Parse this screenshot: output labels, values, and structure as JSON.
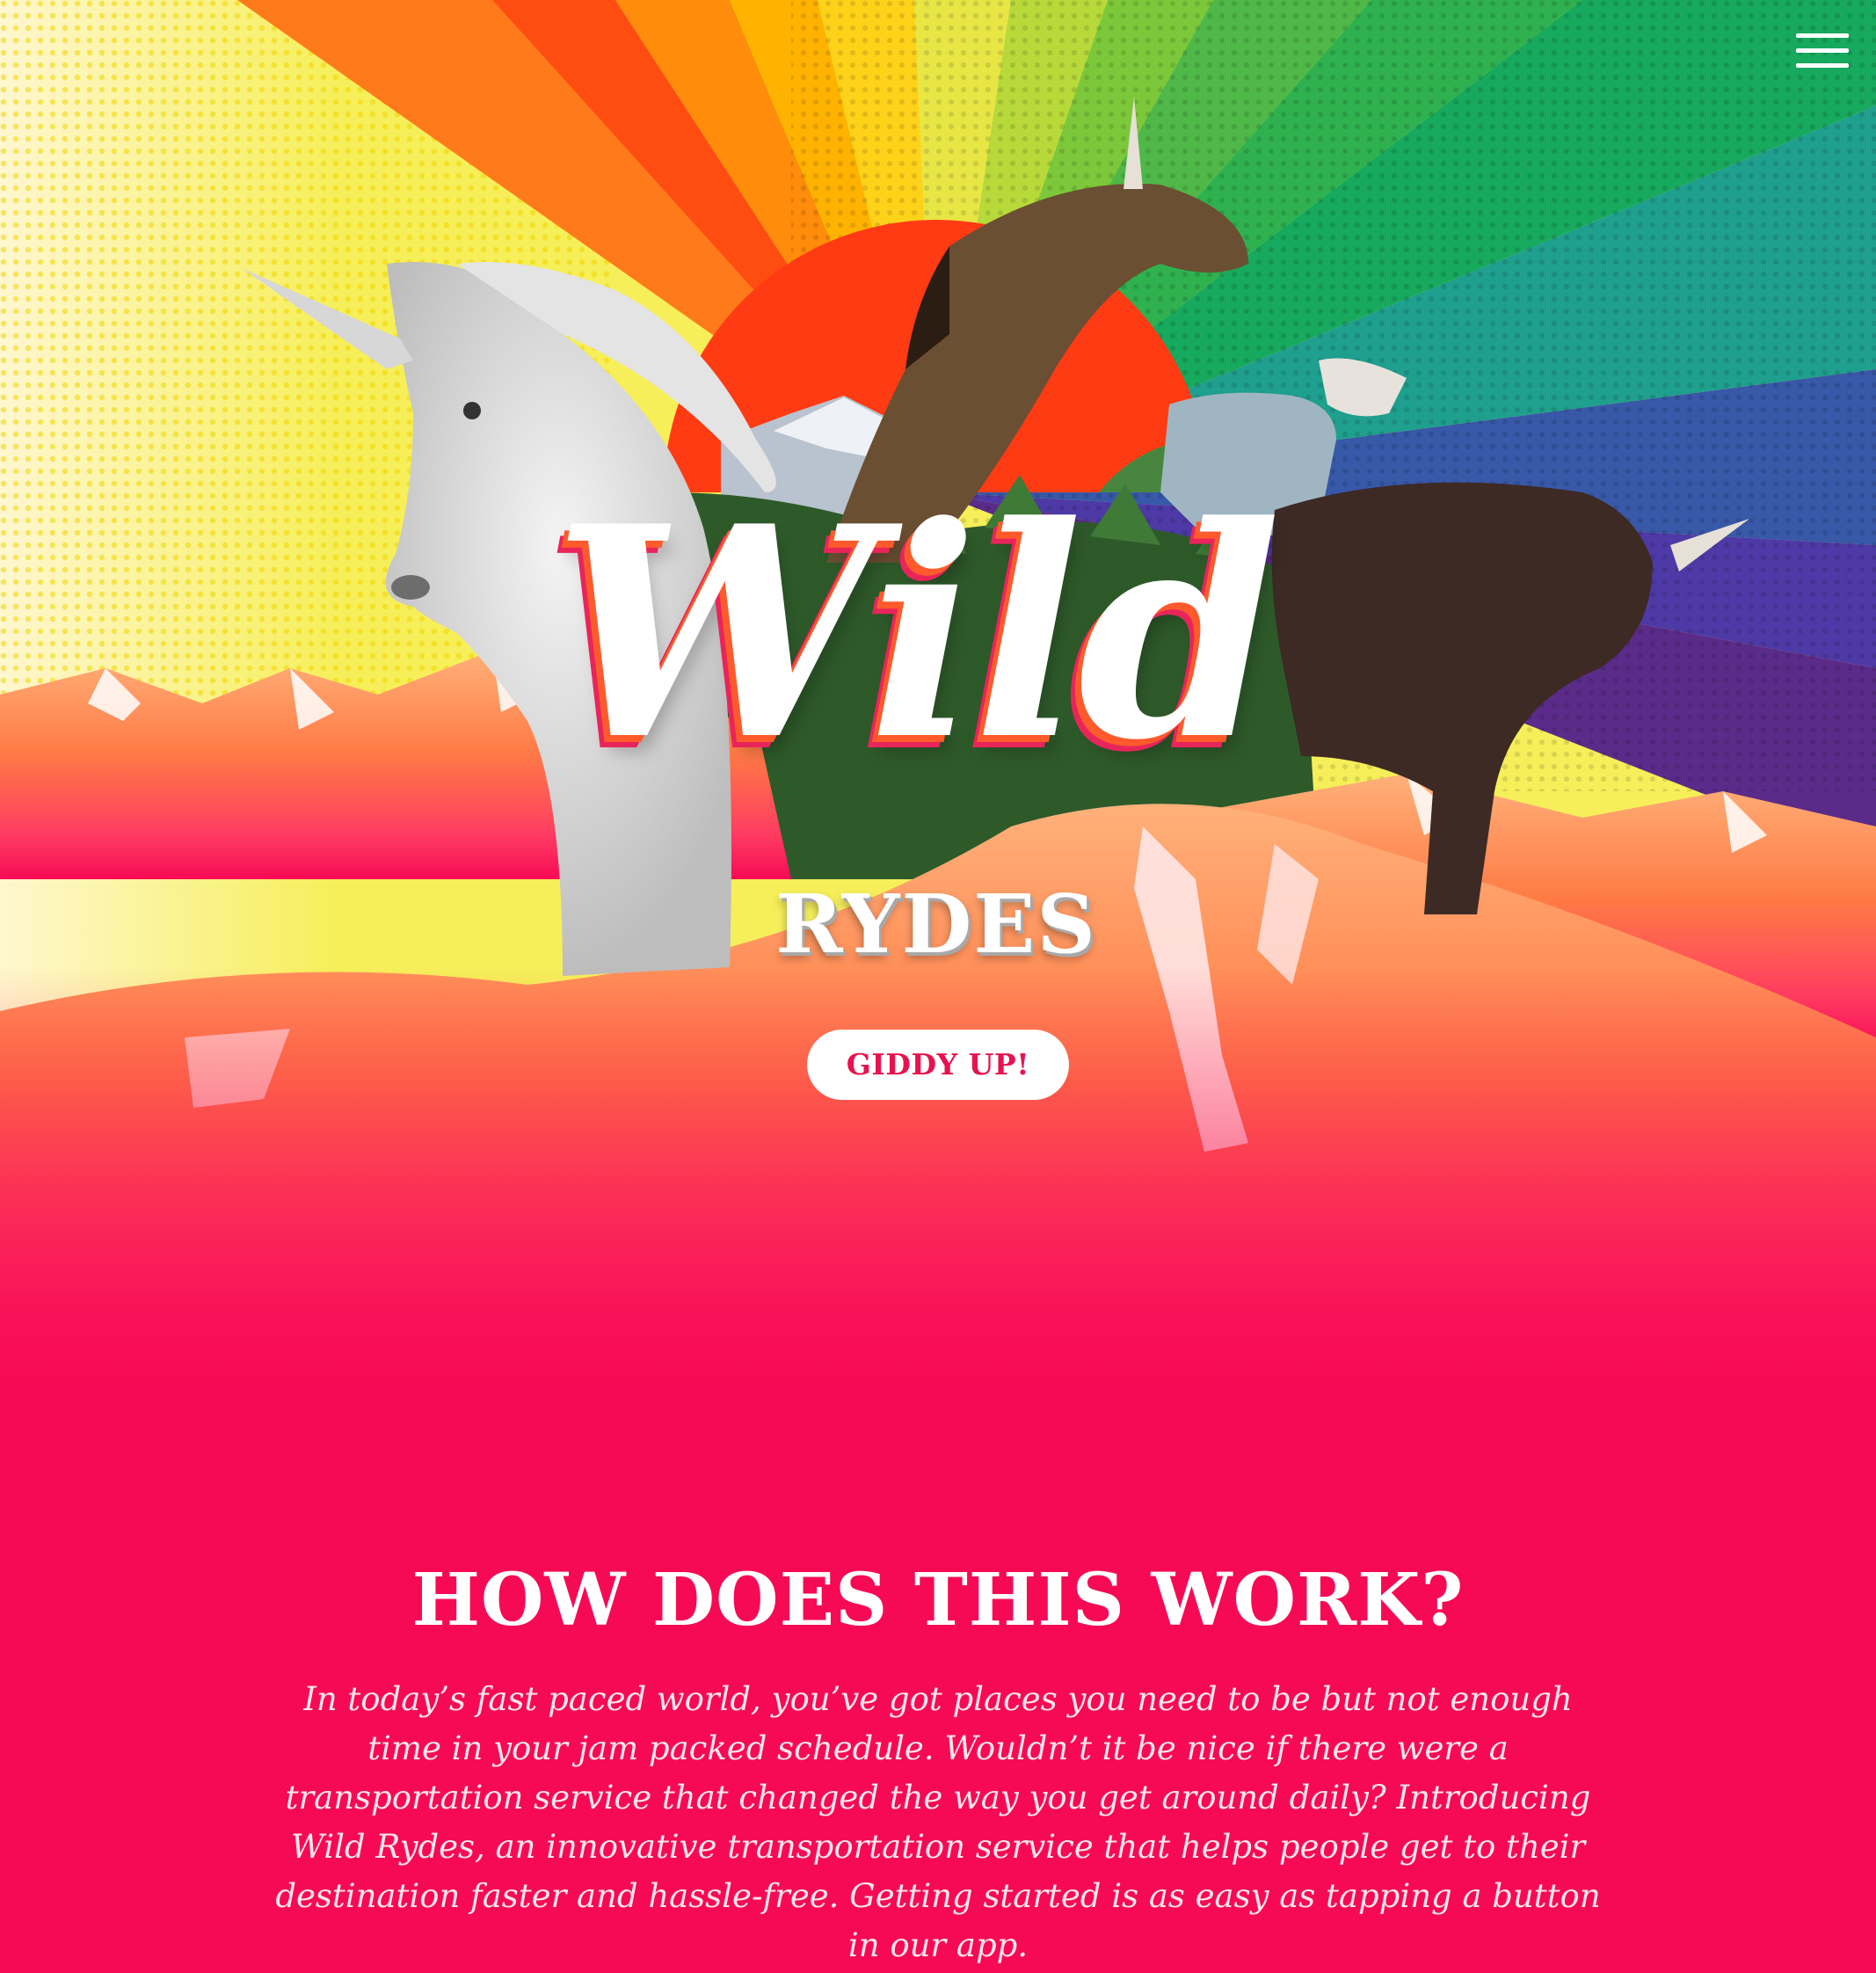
{
  "hero": {
    "logo_wild": "Wild",
    "logo_rydes": "RYDES",
    "cta_label": "GIDDY UP!"
  },
  "menu": {
    "icon": "hamburger-menu-icon"
  },
  "how": {
    "title": "HOW DOES THIS WORK?",
    "body": "In today’s fast paced world, you’ve got places you need to be but not enough time in your jam packed schedule. Wouldn’t it be nice if there were a transportation service that changed the way you get around daily? Introducing Wild Rydes, an innovative transportation service that helps people get to their destination faster and hassle-free. Getting started is as easy as tapping a button in our app."
  },
  "colors": {
    "brand_pink": "#f70a55",
    "cta_text": "#e8124e",
    "white": "#ffffff"
  }
}
